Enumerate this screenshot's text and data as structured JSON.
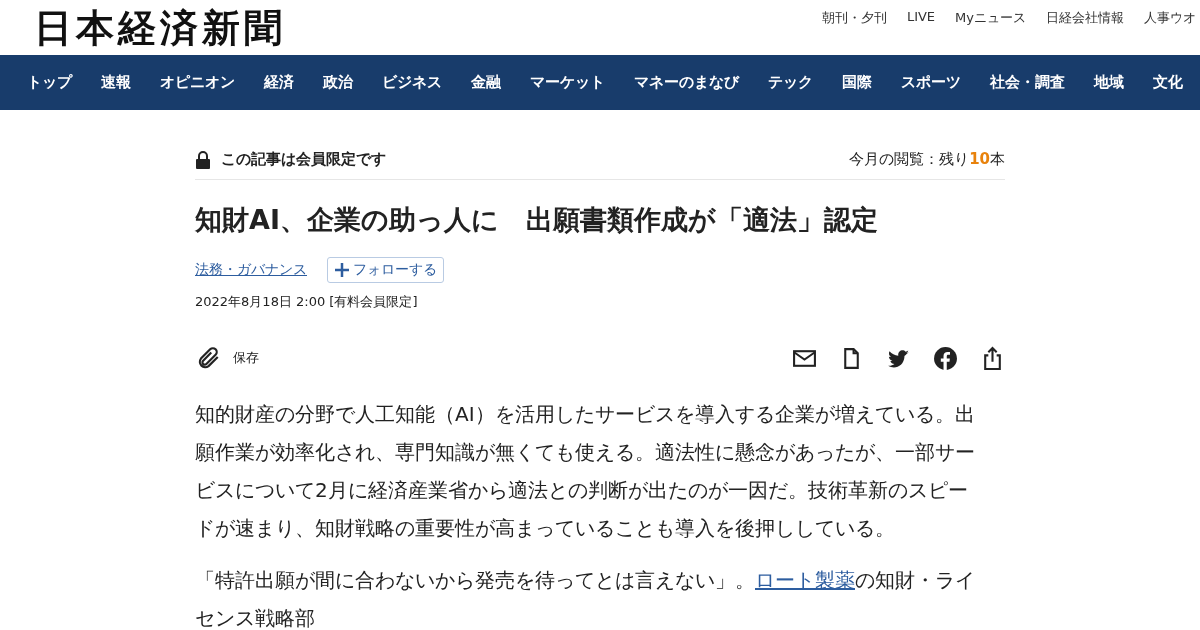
{
  "header": {
    "logo": "日本経済新聞",
    "links": [
      "朝刊・夕刊",
      "LIVE",
      "Myニュース",
      "日経会社情報",
      "人事ウオ"
    ]
  },
  "nav": [
    "トップ",
    "速報",
    "オピニオン",
    "経済",
    "政治",
    "ビジネス",
    "金融",
    "マーケット",
    "マネーのまなび",
    "テック",
    "国際",
    "スポーツ",
    "社会・調査",
    "地域",
    "文化"
  ],
  "article": {
    "members_only": "この記事は会員限定です",
    "quota_prefix": "今月の閲覧：残り",
    "quota_count": "10",
    "quota_suffix": "本",
    "title": "知財AI、企業の助っ人に　出願書類作成が「適法」認定",
    "topic": "法務・ガバナンス",
    "follow": "フォローする",
    "date": "2022年8月18日 2:00 [有料会員限定]",
    "save": "保存",
    "paragraphs": [
      {
        "segments": [
          {
            "kind": "text",
            "text": "知的財産の分野で人工知能（AI）を活用したサービスを導入する企業が増えている。出願作業が効率化され、専門知識が無くても使える。適法性に懸念があったが、一部サービスについて2月に経済産業省から適法との判断が出たのが一因だ。技術革新のスピードが速まり、知財戦略の重要性が高まっていることも導入を後押ししている。"
          }
        ]
      },
      {
        "segments": [
          {
            "kind": "text",
            "text": "「特許出願が間に合わないから発売を待ってとは言えない」。"
          },
          {
            "kind": "link",
            "text": "ロート製薬"
          },
          {
            "kind": "text",
            "text": "の知財・ライセンス戦略部"
          }
        ]
      }
    ]
  }
}
